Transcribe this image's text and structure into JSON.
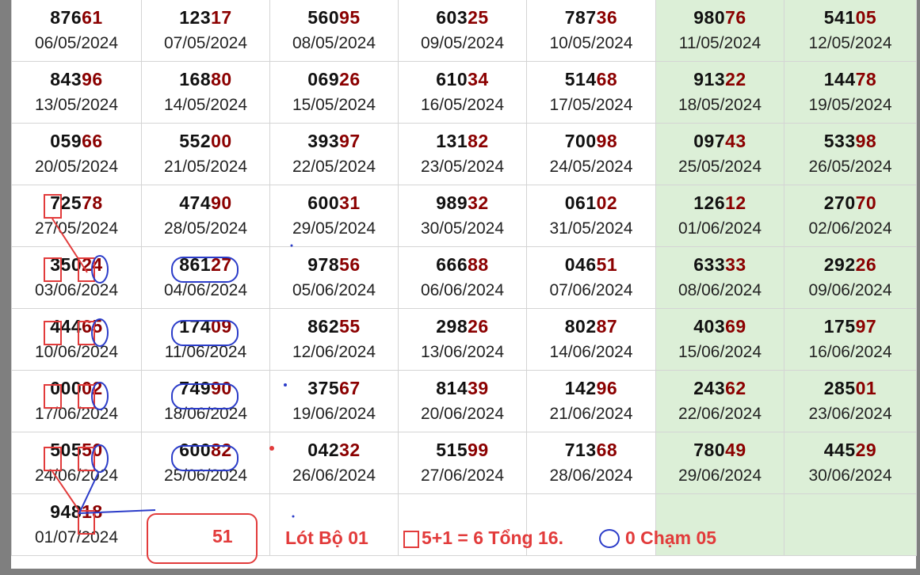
{
  "colors": {
    "prefix": "#111111",
    "suffix": "#8b0000",
    "weekend_bg": "#dcefd7",
    "annotation_red": "#e23b3b",
    "annotation_blue": "#2b3cc9"
  },
  "rows": [
    [
      {
        "pre": "876",
        "suf": "61",
        "date": "06/05/2024"
      },
      {
        "pre": "123",
        "suf": "17",
        "date": "07/05/2024"
      },
      {
        "pre": "560",
        "suf": "95",
        "date": "08/05/2024"
      },
      {
        "pre": "603",
        "suf": "25",
        "date": "09/05/2024"
      },
      {
        "pre": "787",
        "suf": "36",
        "date": "10/05/2024"
      },
      {
        "pre": "980",
        "suf": "76",
        "date": "11/05/2024"
      },
      {
        "pre": "541",
        "suf": "05",
        "date": "12/05/2024"
      }
    ],
    [
      {
        "pre": "843",
        "suf": "96",
        "date": "13/05/2024"
      },
      {
        "pre": "168",
        "suf": "80",
        "date": "14/05/2024"
      },
      {
        "pre": "069",
        "suf": "26",
        "date": "15/05/2024"
      },
      {
        "pre": "610",
        "suf": "34",
        "date": "16/05/2024"
      },
      {
        "pre": "514",
        "suf": "68",
        "date": "17/05/2024"
      },
      {
        "pre": "913",
        "suf": "22",
        "date": "18/05/2024"
      },
      {
        "pre": "144",
        "suf": "78",
        "date": "19/05/2024"
      }
    ],
    [
      {
        "pre": "059",
        "suf": "66",
        "date": "20/05/2024"
      },
      {
        "pre": "552",
        "suf": "00",
        "date": "21/05/2024"
      },
      {
        "pre": "393",
        "suf": "97",
        "date": "22/05/2024"
      },
      {
        "pre": "131",
        "suf": "82",
        "date": "23/05/2024"
      },
      {
        "pre": "700",
        "suf": "98",
        "date": "24/05/2024"
      },
      {
        "pre": "097",
        "suf": "43",
        "date": "25/05/2024"
      },
      {
        "pre": "533",
        "suf": "98",
        "date": "26/05/2024"
      }
    ],
    [
      {
        "pre": "725",
        "suf": "78",
        "date": "27/05/2024"
      },
      {
        "pre": "474",
        "suf": "90",
        "date": "28/05/2024"
      },
      {
        "pre": "600",
        "suf": "31",
        "date": "29/05/2024"
      },
      {
        "pre": "989",
        "suf": "32",
        "date": "30/05/2024"
      },
      {
        "pre": "061",
        "suf": "02",
        "date": "31/05/2024"
      },
      {
        "pre": "126",
        "suf": "12",
        "date": "01/06/2024"
      },
      {
        "pre": "270",
        "suf": "70",
        "date": "02/06/2024"
      }
    ],
    [
      {
        "pre": "350",
        "suf": "24",
        "date": "03/06/2024"
      },
      {
        "pre": "861",
        "suf": "27",
        "date": "04/06/2024"
      },
      {
        "pre": "978",
        "suf": "56",
        "date": "05/06/2024"
      },
      {
        "pre": "666",
        "suf": "88",
        "date": "06/06/2024"
      },
      {
        "pre": "046",
        "suf": "51",
        "date": "07/06/2024"
      },
      {
        "pre": "633",
        "suf": "33",
        "date": "08/06/2024"
      },
      {
        "pre": "292",
        "suf": "26",
        "date": "09/06/2024"
      }
    ],
    [
      {
        "pre": "444",
        "suf": "65",
        "date": "10/06/2024"
      },
      {
        "pre": "174",
        "suf": "09",
        "date": "11/06/2024"
      },
      {
        "pre": "862",
        "suf": "55",
        "date": "12/06/2024"
      },
      {
        "pre": "298",
        "suf": "26",
        "date": "13/06/2024"
      },
      {
        "pre": "802",
        "suf": "87",
        "date": "14/06/2024"
      },
      {
        "pre": "403",
        "suf": "69",
        "date": "15/06/2024"
      },
      {
        "pre": "175",
        "suf": "97",
        "date": "16/06/2024"
      }
    ],
    [
      {
        "pre": "000",
        "suf": "02",
        "date": "17/06/2024"
      },
      {
        "pre": "749",
        "suf": "90",
        "date": "18/06/2024"
      },
      {
        "pre": "375",
        "suf": "67",
        "date": "19/06/2024"
      },
      {
        "pre": "814",
        "suf": "39",
        "date": "20/06/2024"
      },
      {
        "pre": "142",
        "suf": "96",
        "date": "21/06/2024"
      },
      {
        "pre": "243",
        "suf": "62",
        "date": "22/06/2024"
      },
      {
        "pre": "285",
        "suf": "01",
        "date": "23/06/2024"
      }
    ],
    [
      {
        "pre": "505",
        "suf": "50",
        "date": "24/06/2024"
      },
      {
        "pre": "600",
        "suf": "82",
        "date": "25/06/2024"
      },
      {
        "pre": "042",
        "suf": "32",
        "date": "26/06/2024"
      },
      {
        "pre": "515",
        "suf": "99",
        "date": "27/06/2024"
      },
      {
        "pre": "713",
        "suf": "68",
        "date": "28/06/2024"
      },
      {
        "pre": "780",
        "suf": "49",
        "date": "29/06/2024"
      },
      {
        "pre": "445",
        "suf": "29",
        "date": "30/06/2024"
      }
    ]
  ],
  "last_row": {
    "pre": "948",
    "suf": "18",
    "date": "01/07/2024"
  },
  "annotations": {
    "predicted_value": "51",
    "lot_text": "Lót Bộ 01",
    "sum_text": "5+1 = 6 Tổng 16.",
    "cham_text": "0 Chạm 05"
  }
}
